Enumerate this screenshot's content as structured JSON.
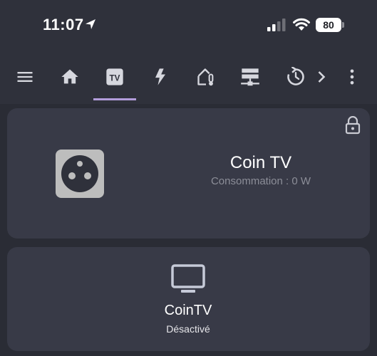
{
  "status_bar": {
    "time": "11:07",
    "battery": "80",
    "icons": [
      "location-arrow-icon",
      "cellular-signal-icon",
      "wifi-icon",
      "battery-icon"
    ]
  },
  "toolbar": {
    "tabs": [
      {
        "icon": "menu-icon"
      },
      {
        "icon": "home-icon"
      },
      {
        "icon": "tv-icon",
        "label": "TV",
        "active": true
      },
      {
        "icon": "lightning-icon"
      },
      {
        "icon": "home-thermometer-icon"
      },
      {
        "icon": "server-network-icon"
      },
      {
        "icon": "history-icon"
      },
      {
        "icon": "chevron-right-icon"
      },
      {
        "icon": "more-vertical-icon"
      }
    ],
    "accent_color": "#b39ddb"
  },
  "outlet_card": {
    "name": "Coin TV",
    "consumption": "Consommation : 0 W",
    "lock_icon": "lock-icon",
    "device_icon": "power-socket-fr-icon"
  },
  "tv_card": {
    "name": "CoinTV",
    "state": "Désactivé",
    "device_icon": "television-icon"
  }
}
